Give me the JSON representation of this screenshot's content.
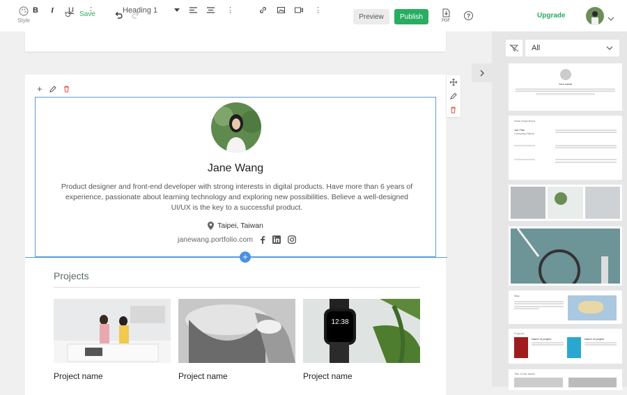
{
  "header": {
    "style_label": "Style",
    "save_label": "Save",
    "preview_label": "Preview",
    "publish_label": "Publish",
    "pdf_label": "PDF",
    "help_label": "?",
    "upgrade_label": "Upgrade"
  },
  "toolbar": {
    "bold": "B",
    "italic": "I",
    "underline": "U",
    "heading": "Heading 1"
  },
  "profile": {
    "name": "Jane Wang",
    "bio": "Product designer and front-end developer with strong interests in digital products. Have more than 6 years of experience, passionate about learning technology and exploring new possibilities. Believe a well-designed UI/UX is the key to a successful product.",
    "location": "Taipei, Taiwan",
    "website": "janewang.portfolio.com"
  },
  "projects": {
    "title": "Projects",
    "items": [
      {
        "name": "Project name"
      },
      {
        "name": "Project name"
      },
      {
        "name": "Project name"
      }
    ]
  },
  "panel": {
    "filter_value": "All",
    "templates": {
      "t1_name": "Your name",
      "t2_title": "Work Experience",
      "t2_job": "Job Title",
      "t2_company": "Company Name",
      "t5_title": "Map",
      "t6_title": "Projects",
      "t6_name": "Name of project",
      "t7_title": "Title of the slides"
    }
  },
  "colors": {
    "accent": "#27ae60",
    "selection": "#5b9bd5",
    "add": "#4a90e2",
    "delete": "#e74c3c"
  }
}
